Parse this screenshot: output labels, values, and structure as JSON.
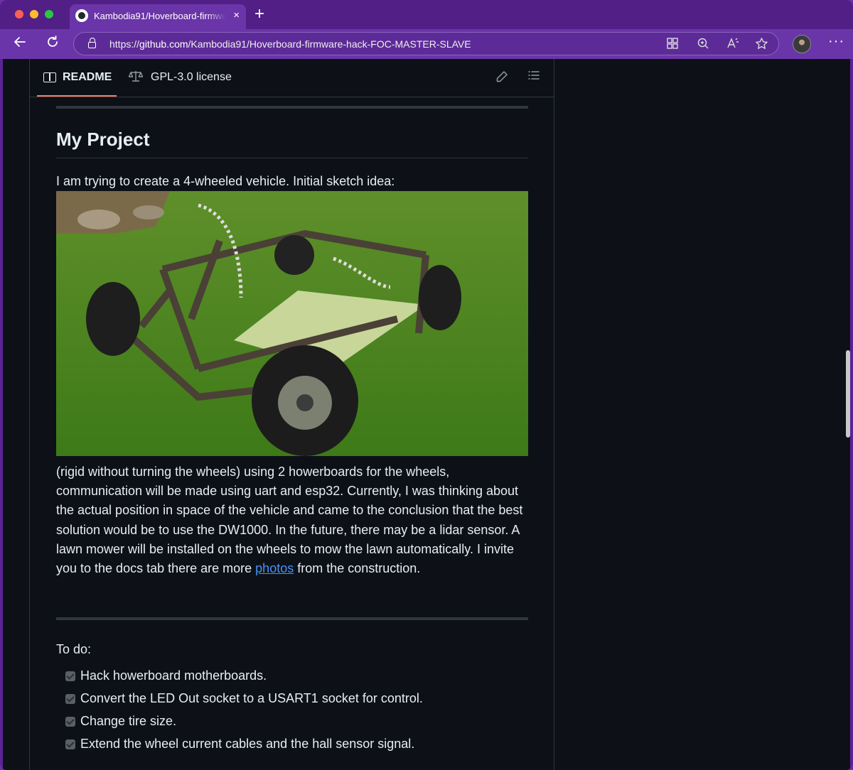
{
  "browser": {
    "tab_title": "Kambodia91/Hoverboard-firmware-hack-FOC-MASTER-SLAVE",
    "tab_close": "×",
    "new_tab": "+",
    "url_prefix": "https://",
    "url_host": "github.com",
    "url_path": "/Kambodia91/Hoverboard-firmware-hack-FOC-MASTER-SLAVE",
    "more": "···"
  },
  "readme_header": {
    "readme_tab": "README",
    "license_tab": "GPL-3.0 license"
  },
  "content": {
    "heading": "My Project",
    "intro": "I am trying to create a 4-wheeled vehicle. Initial sketch idea:",
    "body_before_link": "(rigid without turning the wheels) using 2 howerboards for the wheels, communication will be made using uart and esp32. Currently, I was thinking about the actual position in space of the vehicle and came to the conclusion that the best solution would be to use the DW1000. In the future, there may be a lidar sensor. A lawn mower will be installed on the wheels to mow the lawn automatically. I invite you to the docs tab there are more ",
    "link_text": "photos",
    "body_after_link": " from the construction.",
    "todo_title": "To do:",
    "todo_items": [
      "Hack howerboard motherboards.",
      "Convert the LED Out socket to a USART1 socket for control.",
      "Change tire size.",
      "Extend the wheel current cables and the hall sensor signal."
    ]
  },
  "colors": {
    "browser_purple": "#6a35a8",
    "page_background": "#0d1117",
    "text": "#e6edf3",
    "link": "#4493f8",
    "active_tab_underline": "#f78166"
  }
}
